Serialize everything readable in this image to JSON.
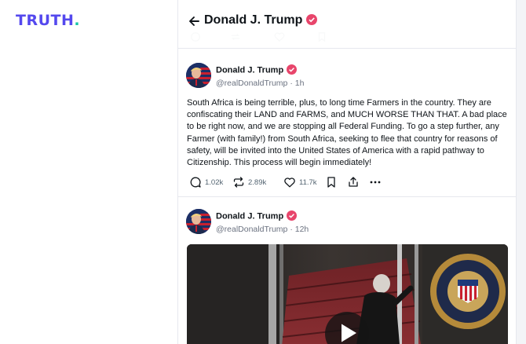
{
  "app": {
    "logo_text": "TRUTH",
    "logo_dot": ".",
    "brand_color": "#5448ee",
    "accent_color": "#17c6a6"
  },
  "header": {
    "title": "Donald J. Trump",
    "back_icon": "arrow-left-icon",
    "verified_color": "#e8456b"
  },
  "previous_post_actions": {
    "icons": [
      "reply-icon",
      "retruth-icon",
      "like-icon",
      "bookmark-icon"
    ]
  },
  "posts": [
    {
      "author": "Donald J. Trump",
      "handle": "@realDonaldTrump",
      "separator": "·",
      "time": "1h",
      "text": "South Africa is being terrible, plus, to long time Farmers in the country. They are confiscating their LAND and FARMS, and MUCH WORSE THAN THAT. A bad place to be right now, and we are stopping all Federal Funding. To go a step further, any Farmer (with family!) from South Africa, seeking to flee that country for reasons of safety, will be invited into the United States of America with a rapid pathway to Citizenship. This process will begin immediately!",
      "replies": "1.02k",
      "retruths": "2.89k",
      "likes": "11.7k"
    },
    {
      "author": "Donald J. Trump",
      "handle": "@realDonaldTrump",
      "separator": "·",
      "time": "12h",
      "media": {
        "type": "video",
        "play_icon": "play-icon"
      }
    }
  ]
}
